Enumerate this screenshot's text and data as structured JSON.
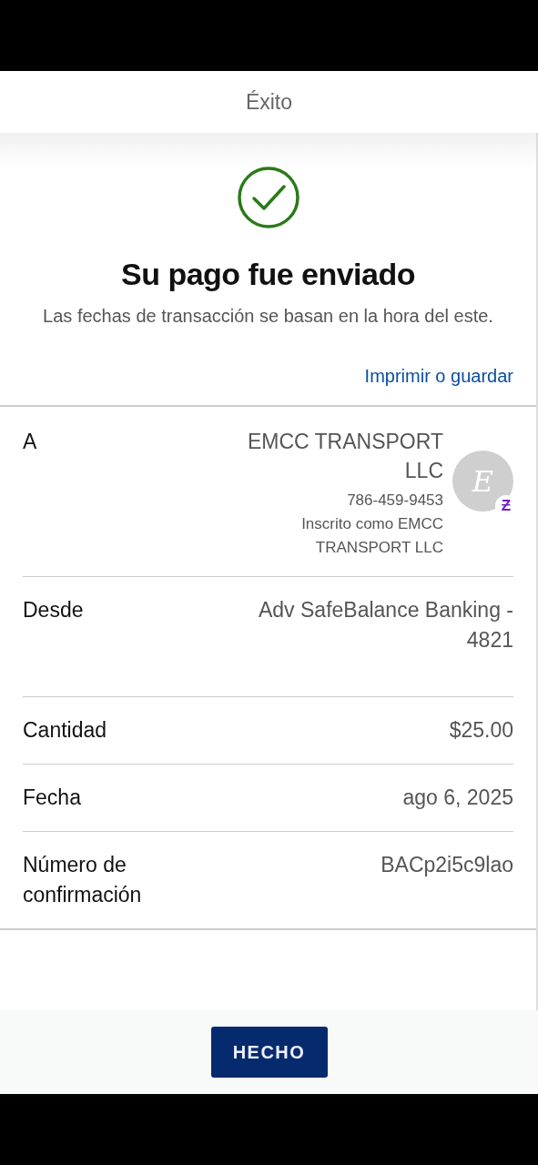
{
  "header": {
    "title": "Éxito"
  },
  "confirmation": {
    "heading": "Su pago fue enviado",
    "note": "Las fechas de transacción se basan en la hora del este.",
    "print_link": "Imprimir o guardar"
  },
  "details": [
    {
      "kind": "recipient",
      "label": "A",
      "name": "EMCC TRANSPORT LLC",
      "phone": "786-459-9453",
      "enrolled": "Inscrito como EMCC TRANSPORT LLC",
      "avatar": {
        "initial": "E",
        "badge": "Ƶ"
      }
    },
    {
      "kind": "text",
      "label": "Desde",
      "value": "Adv SafeBalance Banking - 4821"
    },
    {
      "kind": "text",
      "label": "Cantidad",
      "value": "$25.00"
    },
    {
      "kind": "text",
      "label": "Fecha",
      "value": "ago 6, 2025"
    },
    {
      "kind": "text",
      "label": "Número de confirmación",
      "value": "BACp2i5c9lao"
    }
  ],
  "done_button": "HECHO"
}
